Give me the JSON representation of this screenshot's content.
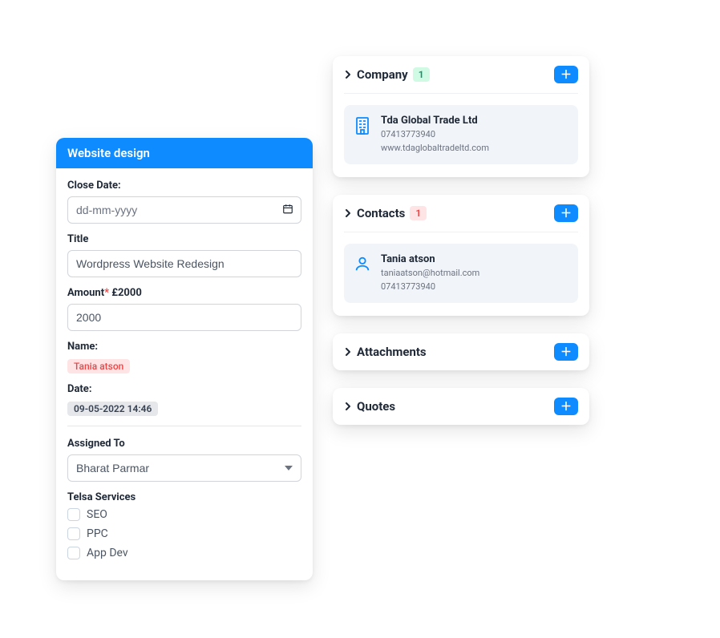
{
  "form": {
    "header": "Website design",
    "close_date": {
      "label": "Close Date:",
      "placeholder": "dd-mm-yyyy",
      "value": ""
    },
    "title": {
      "label": "Title",
      "value": "Wordpress Website Redesign"
    },
    "amount": {
      "label_prefix": "Amount",
      "required_mark": "*",
      "label_suffix": "£2000",
      "value": "2000"
    },
    "name": {
      "label": "Name:",
      "value": "Tania atson"
    },
    "date": {
      "label": "Date:",
      "value": "09-05-2022 14:46"
    },
    "assigned_to": {
      "label": "Assigned To",
      "value": "Bharat Parmar"
    },
    "services": {
      "label": "Telsa Services",
      "items": [
        "SEO",
        "PPC",
        "App Dev"
      ]
    }
  },
  "company": {
    "title": "Company",
    "count": "1",
    "name": "Tda Global Trade Ltd",
    "phone": "07413773940",
    "website": "www.tdaglobaltradeltd.com"
  },
  "contacts": {
    "title": "Contacts",
    "count": "1",
    "name": "Tania atson",
    "email": "taniaatson@hotmail.com",
    "phone": "07413773940"
  },
  "attachments": {
    "title": "Attachments"
  },
  "quotes": {
    "title": "Quotes"
  }
}
